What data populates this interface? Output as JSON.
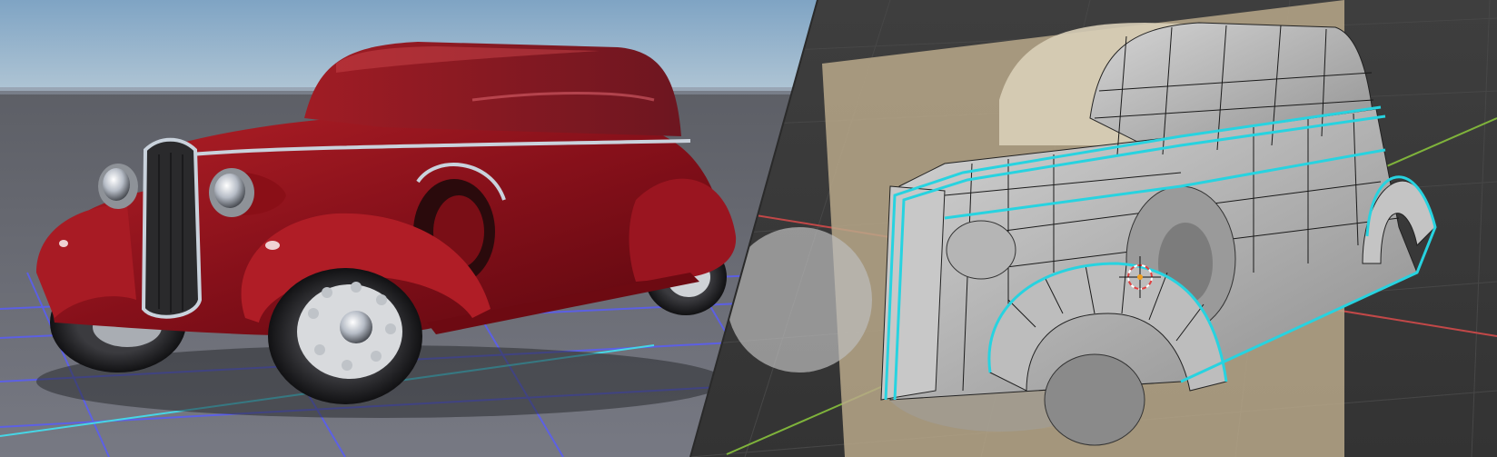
{
  "image": {
    "description_visible_text": "",
    "left_panel": {
      "icon": "red-vintage-car-render",
      "sky_color": "#8fb0cc",
      "ground_color": "#6e7079",
      "grid_color": "#6a6cf0",
      "axis_color": "#46d6e6",
      "car_body_color": "#8a0e14"
    },
    "right_panel": {
      "icon": "car-wireframe-mesh-viewport",
      "background_color": "#3c3c3c",
      "mesh_color": "#a8a8a8",
      "selection_color": "#27d3e0",
      "reference_plane_color": "#b8a889",
      "x_axis_color": "#c24848",
      "y_axis_color": "#7fb33b"
    }
  }
}
